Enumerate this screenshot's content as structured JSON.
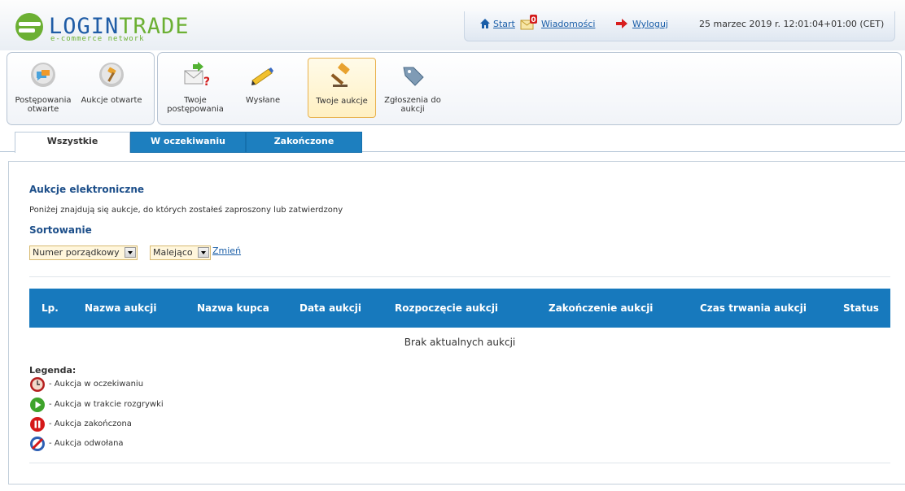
{
  "header": {
    "logo": {
      "word_main": "LOGIN",
      "word_accent": "TRADE",
      "tagline": "e-commerce network"
    },
    "nav": {
      "start": "Start",
      "messages": "Wiadomości",
      "messages_badge": "0",
      "logout": "Wyloguj",
      "datetime": "25 marzec 2019 r. 12:01:04+01:00 (CET)"
    }
  },
  "toolbar": {
    "group1": [
      {
        "label": "Postępowania otwarte",
        "icon": "speech-bubble-icon"
      },
      {
        "label": "Aukcje otwarte",
        "icon": "gavel-bubble-icon"
      }
    ],
    "group2": [
      {
        "label": "Twoje postępowania",
        "icon": "envelope-question-icon"
      },
      {
        "label": "Wysłane",
        "icon": "pencil-icon"
      },
      {
        "label": "Twoje aukcje",
        "icon": "gavel-icon",
        "selected": true
      },
      {
        "label": "Zgłoszenia do aukcji",
        "icon": "tag-icon"
      }
    ]
  },
  "tabs": [
    {
      "label": "Wszystkie",
      "active": true
    },
    {
      "label": "W oczekiwaniu",
      "active": false
    },
    {
      "label": "Zakończone",
      "active": false
    }
  ],
  "main": {
    "title": "Aukcje elektroniczne",
    "description": "Poniżej znajdują się aukcje, do których zostałeś zaproszony lub zatwierdzony",
    "sort_title": "Sortowanie",
    "sort_field": "Numer porządkowy",
    "sort_order": "Malejąco",
    "change_link": "Zmień"
  },
  "table": {
    "columns": [
      "Lp.",
      "Nazwa aukcji",
      "Nazwa kupca",
      "Data aukcji",
      "Rozpoczęcie aukcji",
      "Zakończenie aukcji",
      "Czas trwania aukcji",
      "Status"
    ],
    "empty_message": "Brak aktualnych aukcji"
  },
  "legend": {
    "title": "Legenda:",
    "items": [
      {
        "label": "- Aukcja w oczekiwaniu",
        "icon": "clock-icon"
      },
      {
        "label": "- Aukcja w trakcie rozgrywki",
        "icon": "play-icon"
      },
      {
        "label": "- Aukcja zakończona",
        "icon": "pause-icon"
      },
      {
        "label": "- Aukcja odwołana",
        "icon": "cancelled-icon"
      }
    ]
  },
  "colors": {
    "brand_blue": "#1f5ca6",
    "brand_green": "#6cb033",
    "table_header": "#1779bd",
    "tab_inactive": "#1d7fbf",
    "selected_tool": "#fff0c2"
  }
}
